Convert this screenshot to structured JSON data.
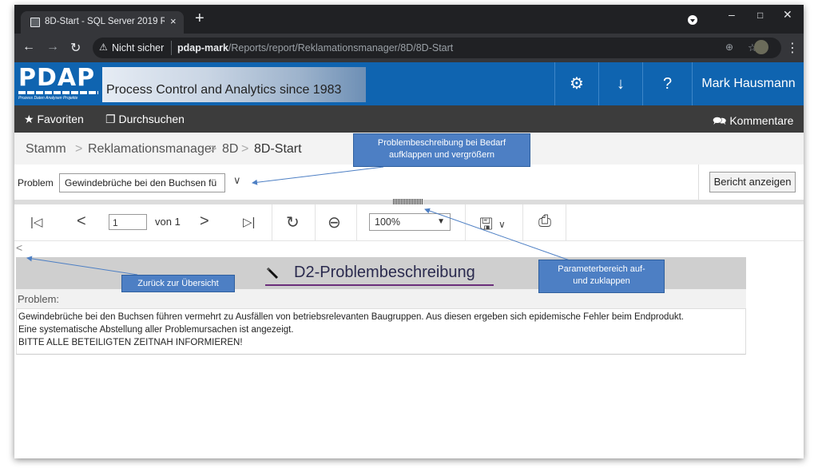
{
  "browser": {
    "tab_title": "8D-Start - SQL Server 2019 Repor",
    "tab_close": "×",
    "new_tab": "+",
    "security": "Nicht sicher",
    "url_host": "pdap-mark",
    "url_path": "/Reports/report/Reklamationsmanager/8D/8D-Start"
  },
  "header": {
    "logo_text": "PDAP",
    "logo_subtext": "Prozess Daten Analysen Projekte",
    "banner_text": "Process Control and Analytics since 1983",
    "settings_icon": "⚙",
    "download_icon": "↓",
    "help_icon": "?",
    "user_name": "Mark Hausmann"
  },
  "toolbar": {
    "favorites_label": "Favoriten",
    "browse_label": "Durchsuchen",
    "comments_label": "Kommentare"
  },
  "breadcrumb": {
    "items": [
      "Stamm",
      "Reklamationsmanager",
      "8D",
      "8D-Start"
    ],
    "separator": ">"
  },
  "params": {
    "problem_label": "Problem",
    "problem_value": "Gewindebrüche bei den Buchsen fü",
    "view_report_button": "Bericht anzeigen"
  },
  "report_toolbar": {
    "first_page": "|◁",
    "prev_page": "<",
    "page_number": "1",
    "page_of": "von 1",
    "next_page": ">",
    "last_page": "▷|",
    "refresh": "↻",
    "back": "⊖",
    "zoom": "100%",
    "save": "🖫",
    "print": "⎙"
  },
  "report": {
    "back_chevron": "<",
    "title": "D2-Problembeschreibung",
    "section_label": "Problem:",
    "text_line1": "Gewindebrüche bei den Buchsen führen vermehrt zu Ausfällen von betriebsrelevanten Baugruppen. Aus diesen ergeben sich epidemische Fehler beim Endprodukt.",
    "text_line2": "Eine systematische Abstellung aller Problemursachen ist angezeigt.",
    "text_line3": "BITTE ALLE BETEILIGTEN ZEITNAH INFORMIEREN!"
  },
  "callouts": {
    "problem_desc_line1": "Problembeschreibung bei Bedarf",
    "problem_desc_line2": "aufklappen und vergrößern",
    "param_toggle_line1": "Parameterbereich auf-",
    "param_toggle_line2": "und zuklappen",
    "back_overview": "Zurück zur Übersicht",
    "color": "#4d7fc4"
  }
}
